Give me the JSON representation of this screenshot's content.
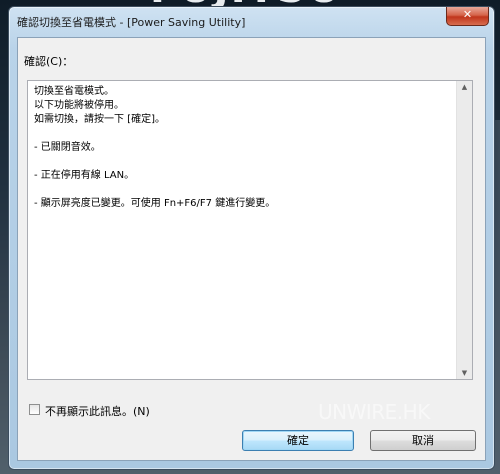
{
  "window": {
    "title": "確認切換至省電模式 - [Power Saving Utility]",
    "close_glyph": "✕"
  },
  "background": {
    "logo_text": "FUJITSU",
    "watermark": "UNWIRE.HK"
  },
  "content": {
    "field_label": "確認(C)：",
    "message_lines": [
      "切換至省電模式。",
      "以下功能將被停用。",
      "如需切換，請按一下 [確定]。",
      "",
      "- 已關閉音效。",
      "",
      "- 正在停用有線 LAN。",
      "",
      "- 顯示屏亮度已變更。可使用 Fn+F6/F7 鍵進行變更。"
    ],
    "scroll_up_glyph": "▲",
    "scroll_down_glyph": "▼"
  },
  "options": {
    "dont_show_label": "不再顯示此訊息。(N)",
    "dont_show_checked": false
  },
  "buttons": {
    "ok_label": "確定",
    "cancel_label": "取消"
  }
}
